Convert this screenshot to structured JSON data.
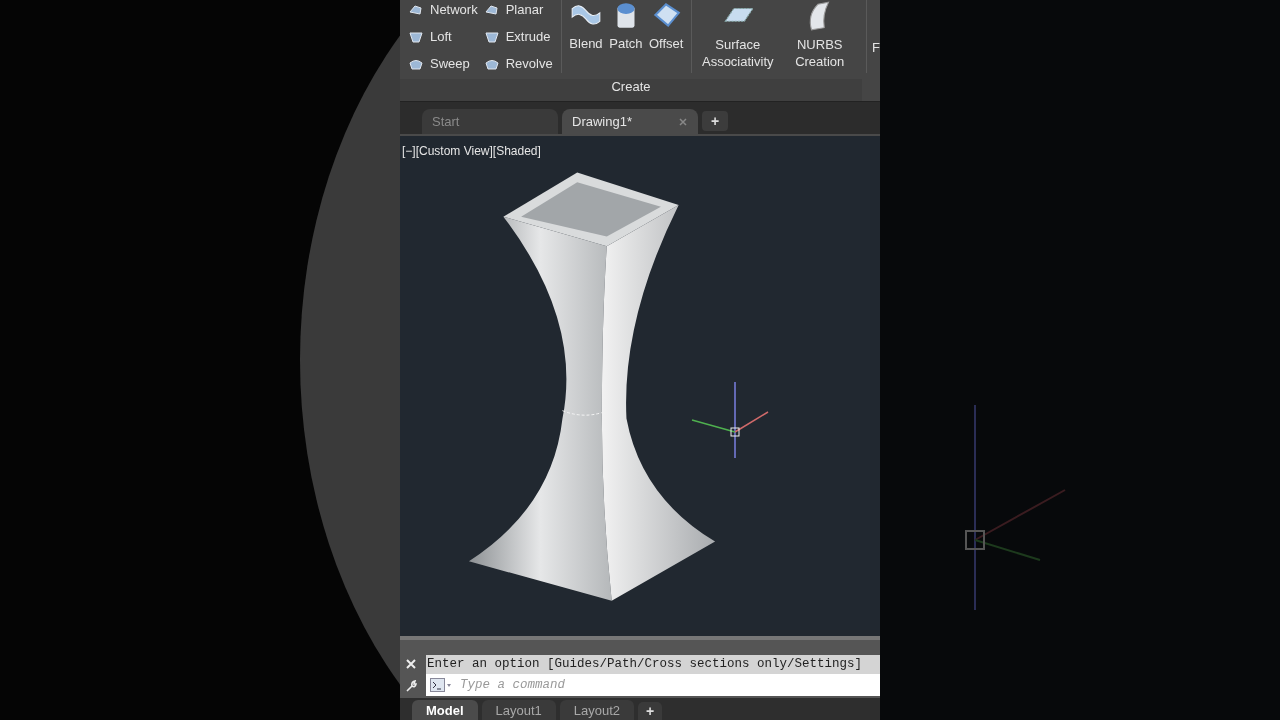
{
  "ribbon": {
    "small_tools": [
      {
        "label": "Network"
      },
      {
        "label": "Loft"
      },
      {
        "label": "Sweep"
      },
      {
        "label": "Planar"
      },
      {
        "label": "Extrude"
      },
      {
        "label": "Revolve"
      }
    ],
    "large_tools": [
      {
        "label": "Blend"
      },
      {
        "label": "Patch"
      },
      {
        "label": "Offset"
      }
    ],
    "wide_tools": [
      {
        "label": "Surface Associativity"
      },
      {
        "label": "NURBS Creation"
      }
    ],
    "cut_tool": "F",
    "panel_title": "Create"
  },
  "file_tabs": [
    {
      "label": "Start",
      "selected": false,
      "closable": false
    },
    {
      "label": "Drawing1*",
      "selected": true,
      "closable": true
    }
  ],
  "new_tab": "+",
  "viewport": {
    "label": "[−][Custom View][Shaded]"
  },
  "command_line": {
    "history": "Enter an option [Guides/Path/Cross sections only/Settings]",
    "placeholder": "Type a command"
  },
  "layout_tabs": [
    {
      "label": "Model",
      "selected": true
    },
    {
      "label": "Layout1",
      "selected": false
    },
    {
      "label": "Layout2",
      "selected": false
    }
  ],
  "layout_add": "+"
}
